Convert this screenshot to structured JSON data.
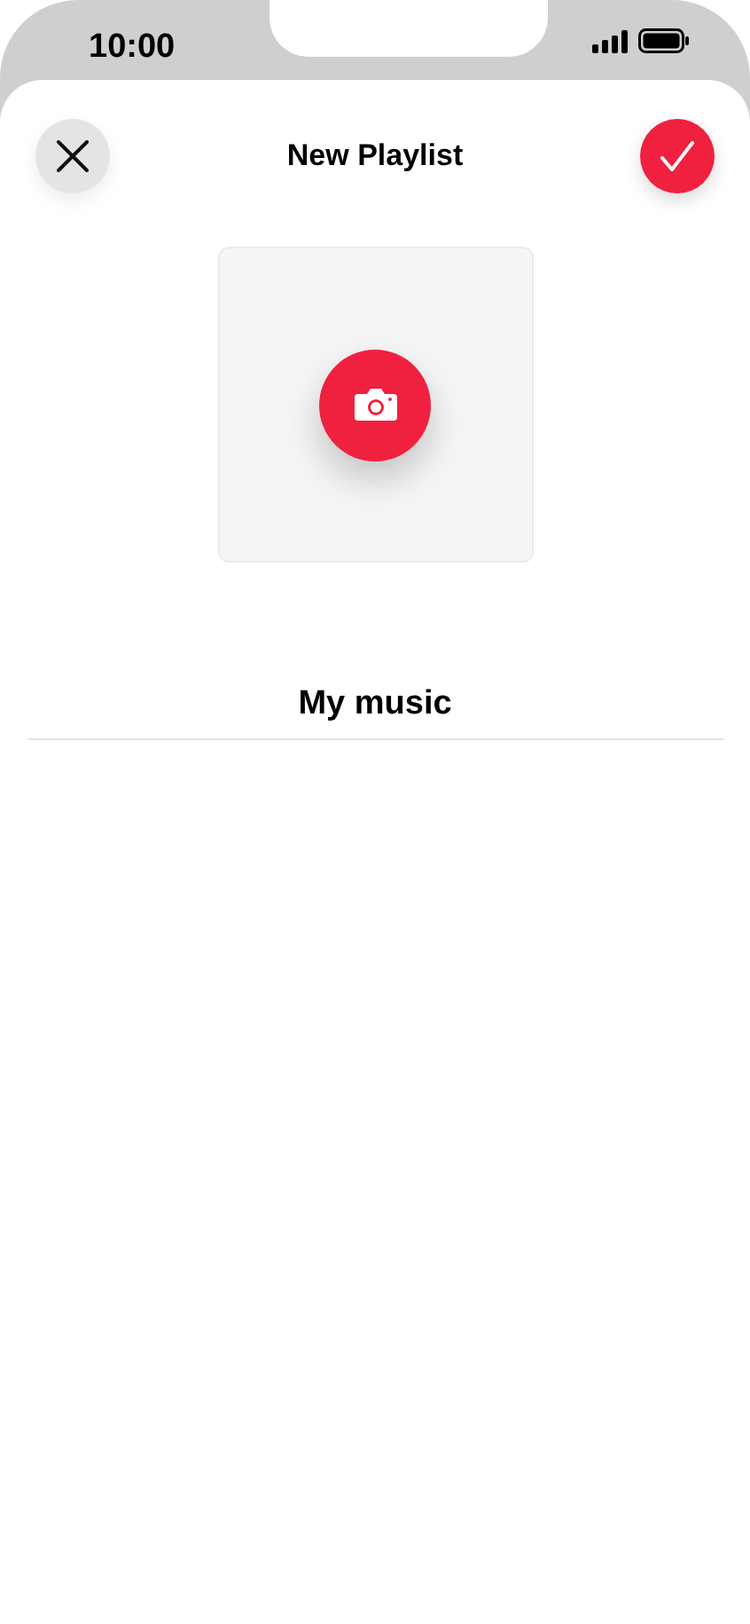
{
  "status_bar": {
    "time": "10:00"
  },
  "header": {
    "title": "New Playlist"
  },
  "playlist_name": {
    "value": "My music"
  }
}
